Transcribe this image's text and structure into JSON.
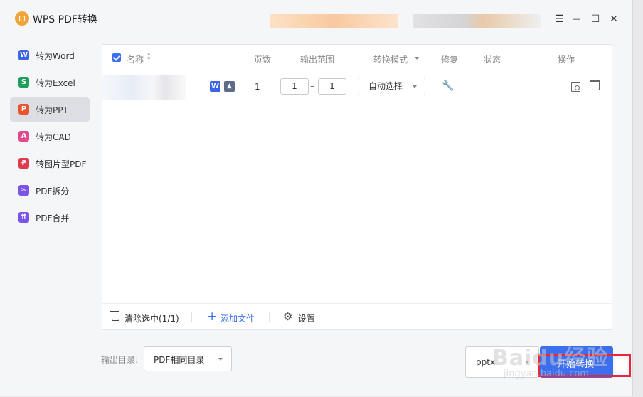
{
  "app": {
    "title": "WPS PDF转换"
  },
  "window_controls": {
    "menu": "☰",
    "minimize": "—",
    "maximize": "☐",
    "close": "✕"
  },
  "sidebar": {
    "items": [
      {
        "label": "转为Word",
        "icon": "word-icon",
        "icon_text": "W",
        "color": "#3b64e8",
        "active": false
      },
      {
        "label": "转为Excel",
        "icon": "excel-icon",
        "icon_text": "S",
        "color": "#1f9e5a",
        "active": false
      },
      {
        "label": "转为PPT",
        "icon": "ppt-icon",
        "icon_text": "P",
        "color": "#e8542c",
        "active": true
      },
      {
        "label": "转为CAD",
        "icon": "cad-icon",
        "icon_text": "A",
        "color": "#e04a8f",
        "active": false
      },
      {
        "label": "转图片型PDF",
        "icon": "image-pdf-icon",
        "icon_text": "₽",
        "color": "#e03a4f",
        "active": false
      },
      {
        "label": "PDF拆分",
        "icon": "split-icon",
        "icon_text": "✂",
        "color": "#7b55e8",
        "active": false
      },
      {
        "label": "PDF合并",
        "icon": "merge-icon",
        "icon_text": "⇈",
        "color": "#7b55e8",
        "active": false
      }
    ]
  },
  "table": {
    "headers": {
      "name": "名称",
      "pages": "页数",
      "range": "输出范围",
      "mode": "转换模式",
      "repair": "修复",
      "status": "状态",
      "action": "操作"
    },
    "rows": [
      {
        "pages": "1",
        "range_from": "1",
        "range_dash": "–",
        "range_to": "1",
        "mode": "自动选择"
      }
    ]
  },
  "footer": {
    "clear": "清除选中(1/1)",
    "add": "添加文件",
    "settings": "设置"
  },
  "bottom": {
    "output_label": "输出目录:",
    "output_value": "PDF相同目录",
    "format": "pptx",
    "start": "开始转换"
  },
  "watermark": {
    "main": "Baidu经验",
    "sub": "jingyan.baidu.com"
  },
  "colors": {
    "accent": "#3a6ff0",
    "highlight": "#e8283a"
  }
}
